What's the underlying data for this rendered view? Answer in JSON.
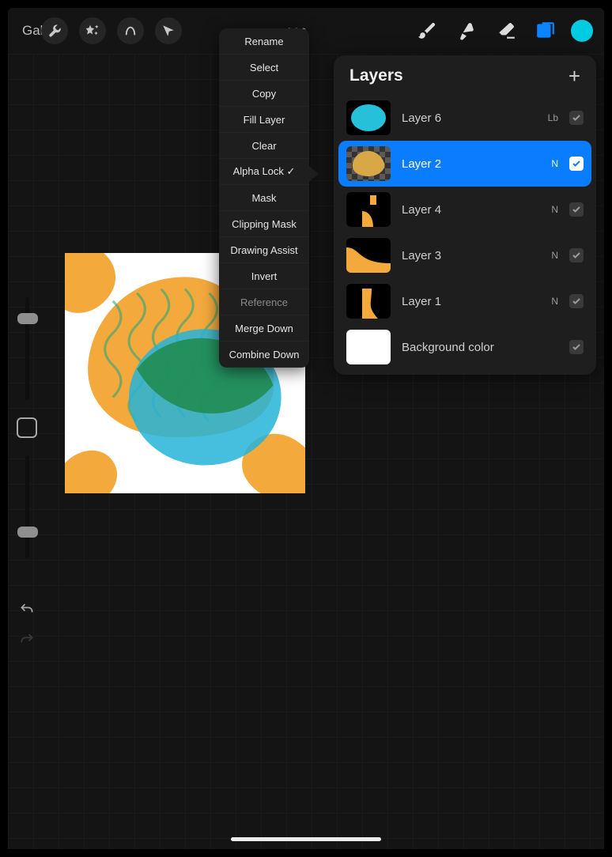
{
  "toolbar": {
    "gallery_label": "Gallery",
    "icons": {
      "wrench": "settings-icon",
      "wand": "adjust-icon",
      "s": "selection-icon",
      "arrow": "move-icon",
      "brush": "brush-icon",
      "smudge": "smudge-icon",
      "eraser": "eraser-icon",
      "layers": "layers-icon"
    },
    "active": "layers",
    "swatch_color": "#00cbe0"
  },
  "context_menu": {
    "items": [
      {
        "label": "Rename",
        "enabled": true
      },
      {
        "label": "Select",
        "enabled": true
      },
      {
        "label": "Copy",
        "enabled": true
      },
      {
        "label": "Fill Layer",
        "enabled": true
      },
      {
        "label": "Clear",
        "enabled": true
      },
      {
        "label": "Alpha Lock ✓",
        "enabled": true
      },
      {
        "label": "Mask",
        "enabled": true
      },
      {
        "label": "Clipping Mask",
        "enabled": true
      },
      {
        "label": "Drawing Assist",
        "enabled": true
      },
      {
        "label": "Invert",
        "enabled": true
      },
      {
        "label": "Reference",
        "enabled": false
      },
      {
        "label": "Merge Down",
        "enabled": true
      },
      {
        "label": "Combine Down",
        "enabled": true
      }
    ]
  },
  "layers_panel": {
    "title": "Layers",
    "rows": [
      {
        "name": "Layer 6",
        "blend": "Lb",
        "checked": true,
        "selected": false,
        "thumb": "circle"
      },
      {
        "name": "Layer 2",
        "blend": "N",
        "checked": true,
        "selected": true,
        "thumb": "blob"
      },
      {
        "name": "Layer 4",
        "blend": "N",
        "checked": true,
        "selected": false,
        "thumb": "shape4"
      },
      {
        "name": "Layer 3",
        "blend": "N",
        "checked": true,
        "selected": false,
        "thumb": "shape3"
      },
      {
        "name": "Layer 1",
        "blend": "N",
        "checked": true,
        "selected": false,
        "thumb": "shape1"
      },
      {
        "name": "Background color",
        "blend": "",
        "checked": true,
        "selected": false,
        "thumb": "bg"
      }
    ]
  }
}
